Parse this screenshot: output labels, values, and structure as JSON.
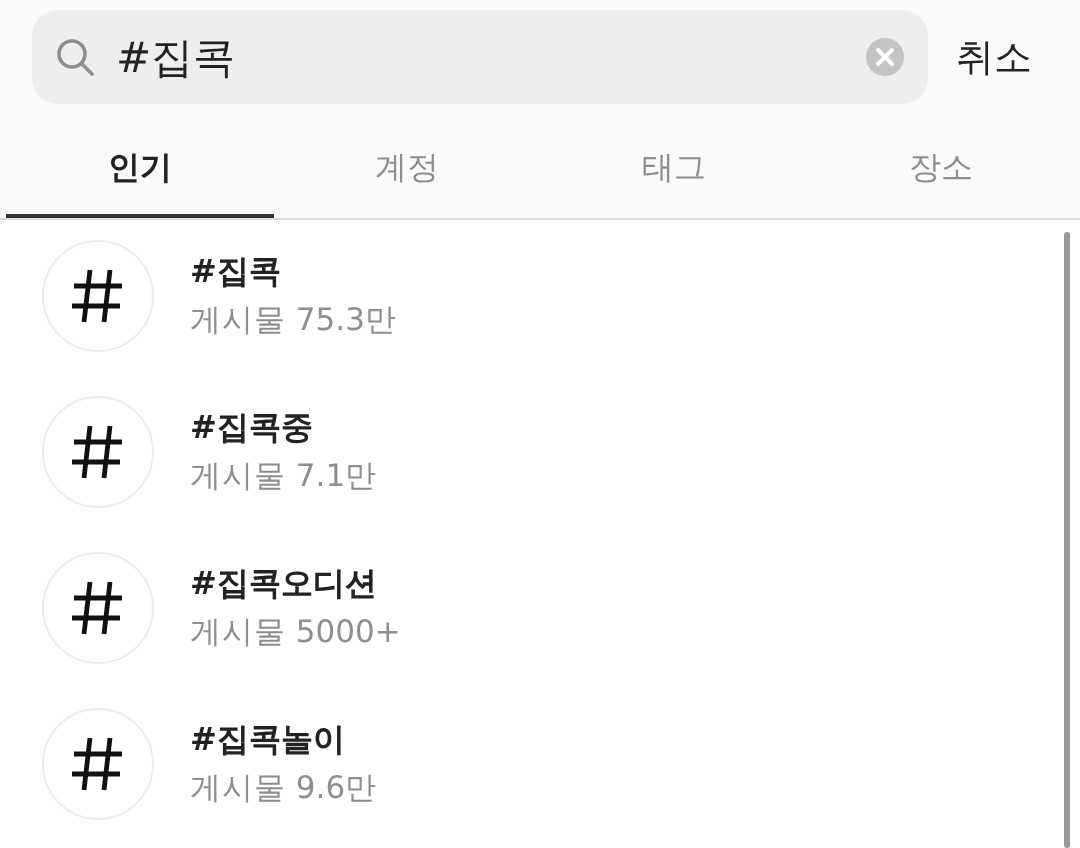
{
  "search": {
    "value": "#집콕"
  },
  "cancel": "취소",
  "tabs": [
    {
      "label": "인기",
      "selected": true
    },
    {
      "label": "계정",
      "selected": false
    },
    {
      "label": "태그",
      "selected": false
    },
    {
      "label": "장소",
      "selected": false
    }
  ],
  "results": [
    {
      "tag": "#집콕",
      "posts": "게시물 75.3만"
    },
    {
      "tag": "#집콕중",
      "posts": "게시물 7.1만"
    },
    {
      "tag": "#집콕오디션",
      "posts": "게시물 5000+"
    },
    {
      "tag": "#집콕놀이",
      "posts": "게시물 9.6만"
    }
  ]
}
